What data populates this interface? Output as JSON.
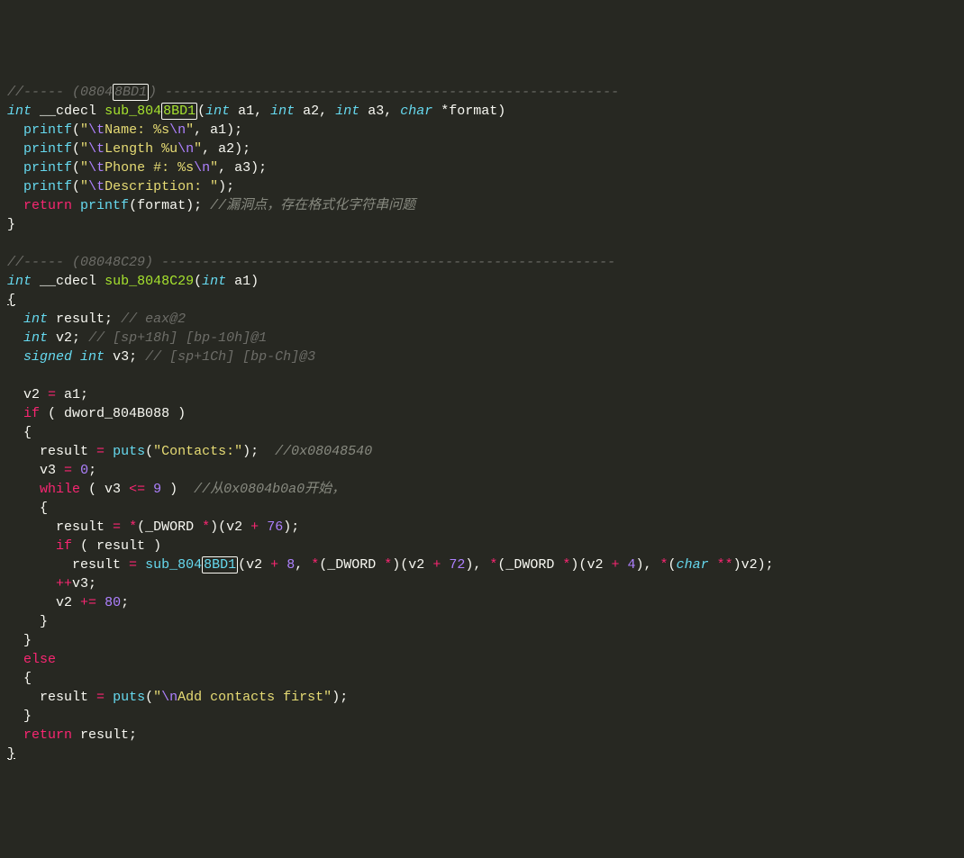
{
  "code": {
    "commentHeader1_prefix": "//----- (0804",
    "commentHeader1_hl": "8BD1",
    "commentHeader1_suffix": ") --------------------------------------------------------",
    "kw_int": "int",
    "kw_char": "char",
    "kw_signed": "signed",
    "kw_return": "return",
    "kw_if": "if",
    "kw_else": "else",
    "kw_while": "while",
    "cdecl": "__cdecl",
    "fn1_name": "sub_804",
    "fn1_hl": "8BD1",
    "fn1_params_open": "(",
    "fn1_p1": " a1,",
    "fn1_p2": " a2,",
    "fn1_p3": " a3,",
    "fn1_p4_star": " *",
    "fn1_p4_name": "format)",
    "printf": "printf",
    "puts": "puts",
    "str_name_open": "\"",
    "esc_t": "\\t",
    "esc_n": "\\n",
    "str_name": "Name: %s",
    "str_length": "Length %u",
    "str_phone": "Phone #: %s",
    "str_desc": "Description: ",
    "str_close": "\"",
    "a1": "a1",
    "a2": "a2",
    "a3": "a3",
    "format": "format",
    "vuln_comment": "//漏洞点，存在格式化字符串问题",
    "commentHeader2": "//----- (08048C29) --------------------------------------------------------",
    "fn2_name": "sub_8048C29",
    "fn2_params": "(",
    "fn2_p1": " a1)",
    "decl_result": "result;",
    "decl_result_comment": "// eax@2",
    "decl_v2": "v2;",
    "decl_v2_comment": "// [sp+18h] [bp-10h]@1",
    "decl_v3": "v3;",
    "decl_v3_comment": "// [sp+1Ch] [bp-Ch]@3",
    "v2_assign": "v2 ",
    "eq": "=",
    "a1_semi": " a1;",
    "dword": "dword_804B088",
    "result": "result",
    "str_contacts": "Contacts:",
    "hex_comment1": "//0x08048540",
    "v3": "v3",
    "zero": "0",
    "nine": "9",
    "le": "<=",
    "while_comment": "//从0x0804b0a0开始，",
    "star_paren": "*",
    "_DWORD": "(_DWORD ",
    "v2": "v2",
    "plus": "+",
    "n76": "76",
    "n72": "72",
    "n4": "4",
    "n8": "8",
    "n80": "80",
    "plusplus": "++",
    "pluseq": "+=",
    "call_sub_prefix": "sub_804",
    "call_sub_hl": "8BD1",
    "char_cast": "char",
    "str_addfirst_open": "\"",
    "str_addfirst": "Add contacts first",
    "result_semi": "result;"
  }
}
